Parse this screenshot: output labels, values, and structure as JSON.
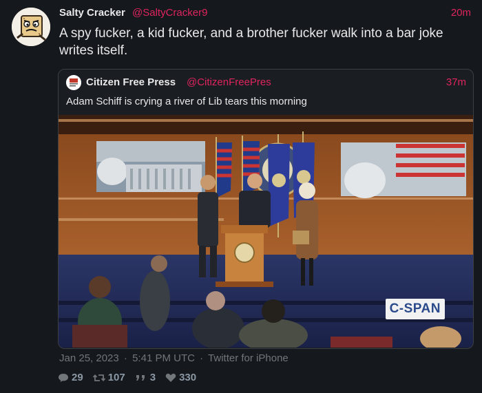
{
  "tweet": {
    "author_name": "Salty Cracker",
    "author_handle": "@SaltyCracker9",
    "time_ago": "20m",
    "text": "A spy fucker, a kid fucker, and a brother fucker walk into a bar joke writes itself."
  },
  "quoted": {
    "author_name": "Citizen Free Press",
    "author_handle": "@CitizenFreePres",
    "time_ago": "37m",
    "text": "Adam Schiff is crying a river of Lib tears this morning",
    "watermark": "C-SPAN"
  },
  "meta": {
    "date": "Jan 25, 2023",
    "separator": "·",
    "time": "5:41 PM UTC",
    "source": "Twitter for iPhone"
  },
  "actions": {
    "replies": "29",
    "retweets": "107",
    "quotes": "3",
    "likes": "330"
  },
  "colors": {
    "background": "#15181c",
    "handle": "#e0245e",
    "muted": "#71767b"
  },
  "icons": {
    "reply": "speech-bubble-icon",
    "retweet": "retweet-icon",
    "quote": "quote-icon",
    "like": "heart-icon"
  }
}
